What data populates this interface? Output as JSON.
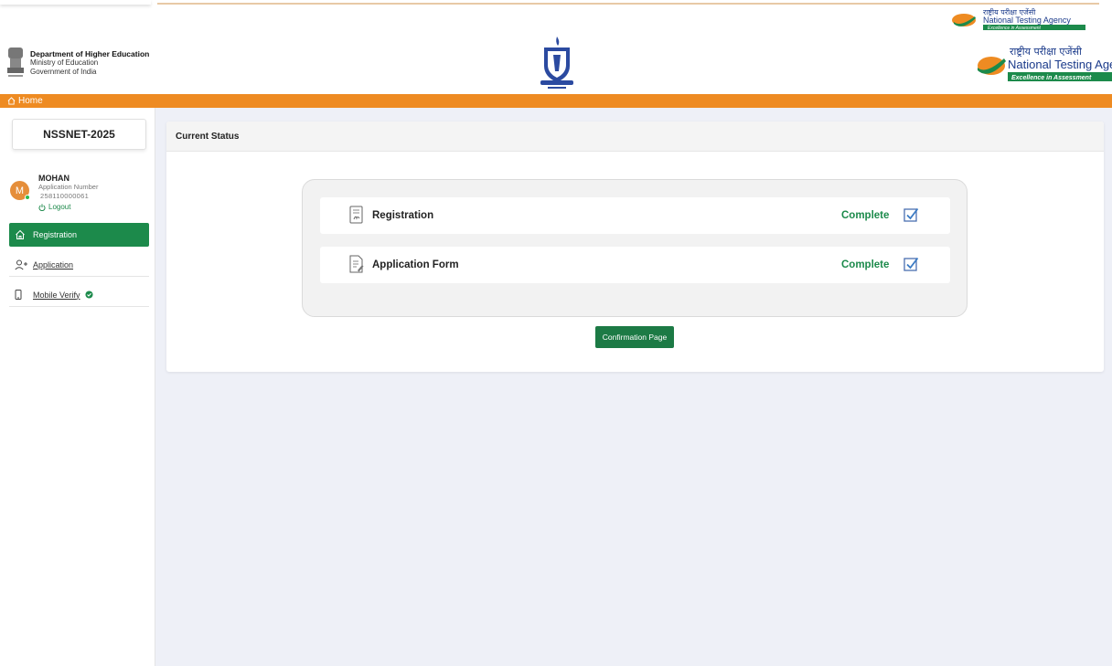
{
  "header": {
    "dhe_line1": "Department of Higher Education",
    "dhe_line2": "Ministry of Education",
    "dhe_line3": "Government of India",
    "nta_hindi": "राष्ट्रीय परीक्षा एजेंसी",
    "nta_english": "National Testing Agency",
    "nta_tagline": "Excellence in Assessment",
    "emblem_icon": "ashoka-emblem-icon",
    "crest_icon": "institution-crest-icon"
  },
  "navbar": {
    "home_label": "Home",
    "home_icon": "home-icon"
  },
  "sidebar": {
    "app_title": "NSSNET-2025",
    "user": {
      "avatar_initial": "M",
      "name": "MOHAN",
      "app_number_label": "Application Number",
      "app_number": "258110000061",
      "logout_label": "Logout"
    },
    "items": [
      {
        "label": "Registration",
        "icon": "home-icon",
        "active": true
      },
      {
        "label": "Application",
        "icon": "add-user-icon",
        "active": false
      },
      {
        "label": "Mobile Verify",
        "icon": "mobile-icon",
        "active": false,
        "verified": true
      }
    ]
  },
  "main": {
    "card_title": "Current Status",
    "rows": [
      {
        "label": "Registration",
        "status": "Complete",
        "icon": "document-sign-icon"
      },
      {
        "label": "Application Form",
        "status": "Complete",
        "icon": "document-edit-icon"
      }
    ],
    "confirm_button": "Confirmation Page"
  },
  "colors": {
    "accent_green": "#1c8a4b",
    "orange_bar": "#ee8b22",
    "background": "#eef0f7"
  }
}
